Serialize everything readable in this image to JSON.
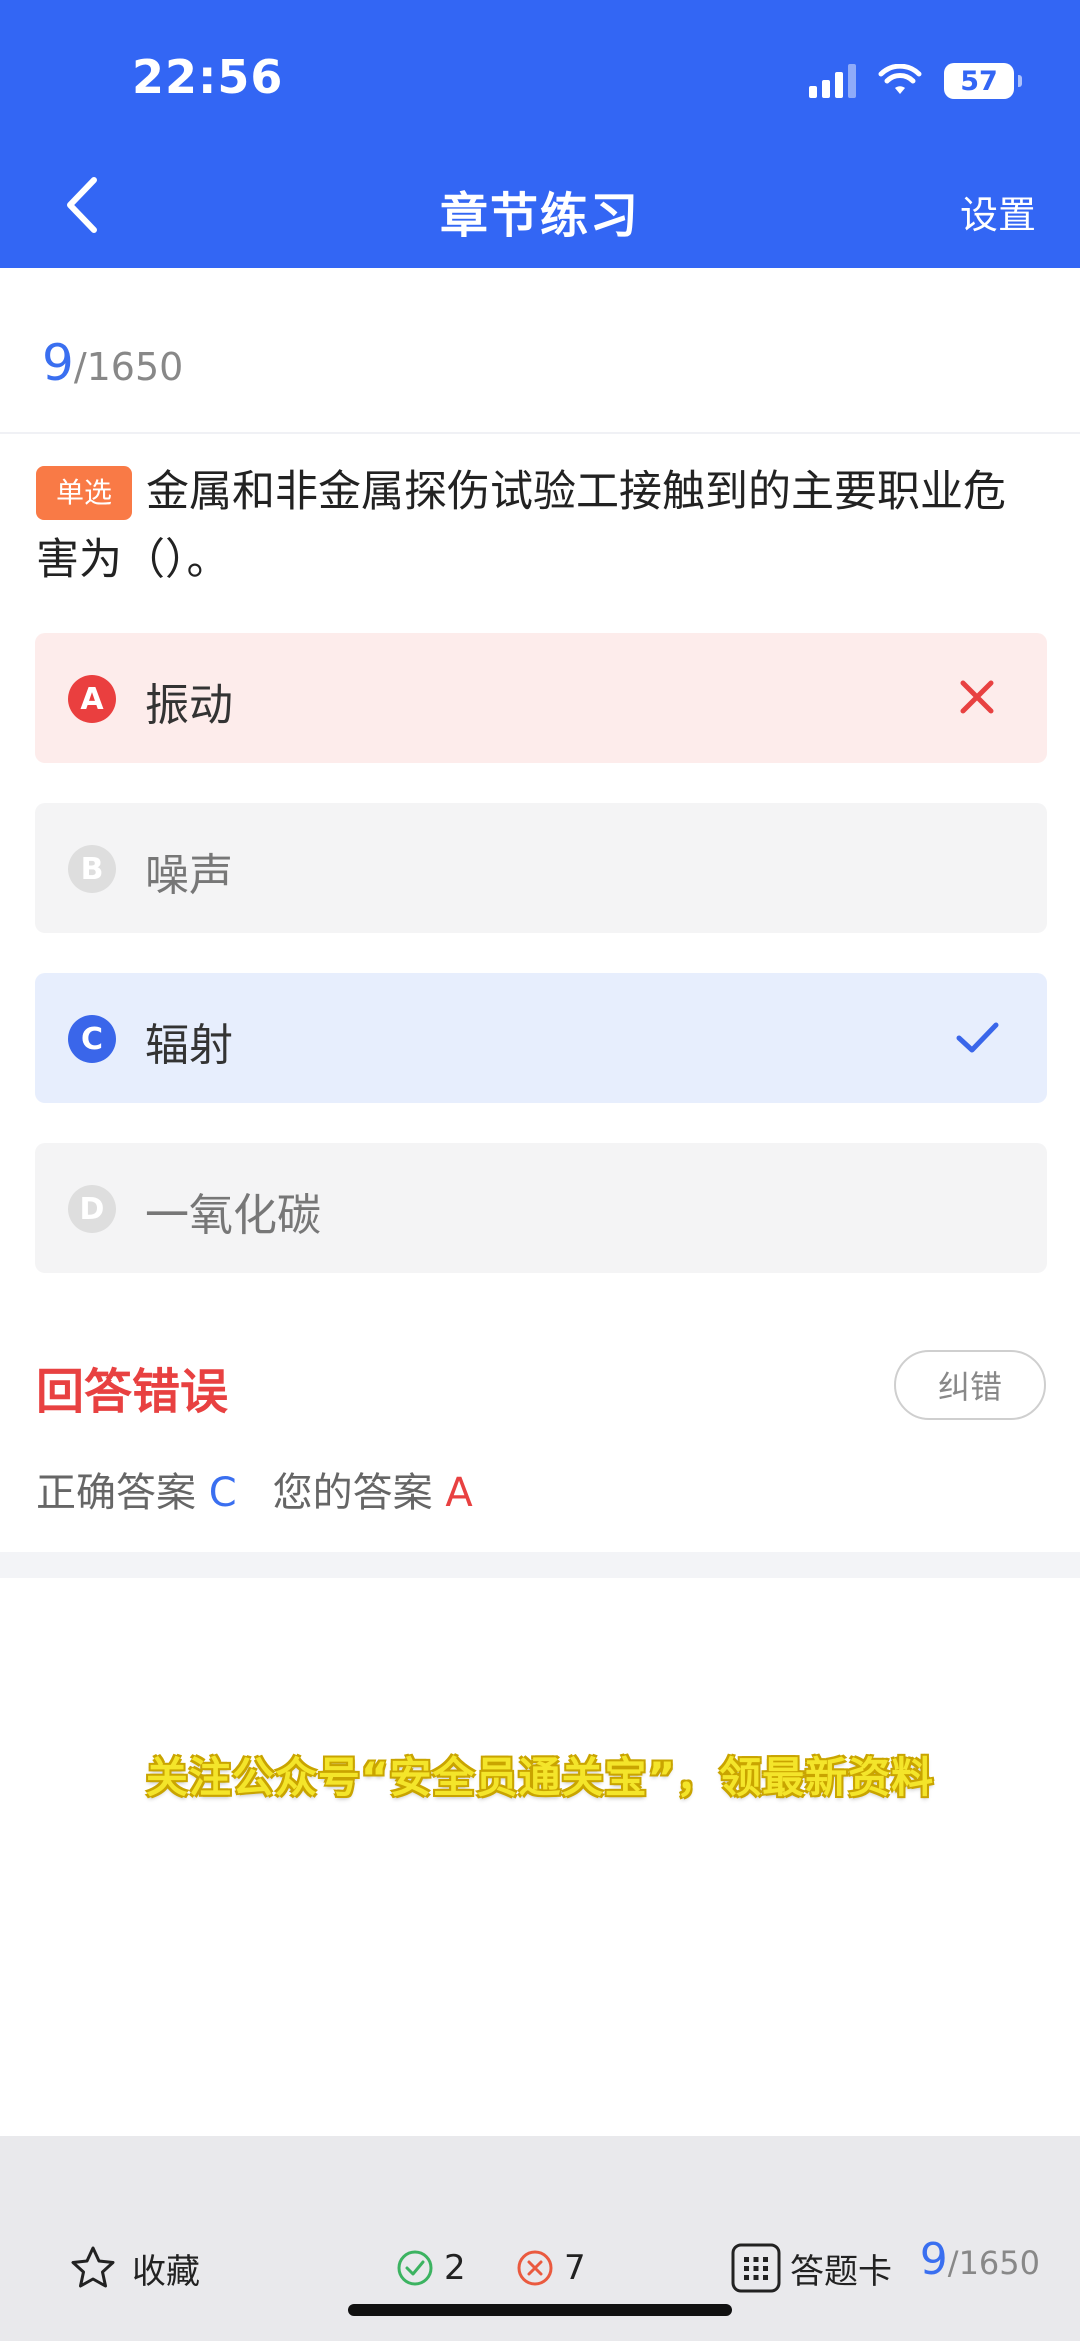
{
  "status_bar": {
    "time": "22:56",
    "battery": "57"
  },
  "header": {
    "title": "章节练习",
    "settings_label": "设置"
  },
  "progress": {
    "current": "9",
    "total": "/1650"
  },
  "question": {
    "type_tag": "单选",
    "text": "金属和非金属探伤试验工接触到的主要职业危害为（）。"
  },
  "options": [
    {
      "letter": "A",
      "text": "振动",
      "state": "wrong"
    },
    {
      "letter": "B",
      "text": "噪声",
      "state": "plain"
    },
    {
      "letter": "C",
      "text": "辐射",
      "state": "correct"
    },
    {
      "letter": "D",
      "text": "一氧化碳",
      "state": "plain"
    }
  ],
  "result": {
    "title": "回答错误",
    "report_label": "纠错",
    "correct_label": "正确答案",
    "correct_value": "C",
    "your_label": "您的答案",
    "your_value": "A"
  },
  "promo": {
    "text": "关注公众号“安全员通关宝”，领最新资料"
  },
  "bottom_bar": {
    "favorite_label": "收藏",
    "correct_count": "2",
    "wrong_count": "7",
    "card_label": "答题卡",
    "progress_current": "9",
    "progress_total": "/1650"
  },
  "colors": {
    "primary": "#3366f4",
    "wrong": "#ea3f3f",
    "correct": "#3a66ea",
    "tag": "#f97a46"
  }
}
